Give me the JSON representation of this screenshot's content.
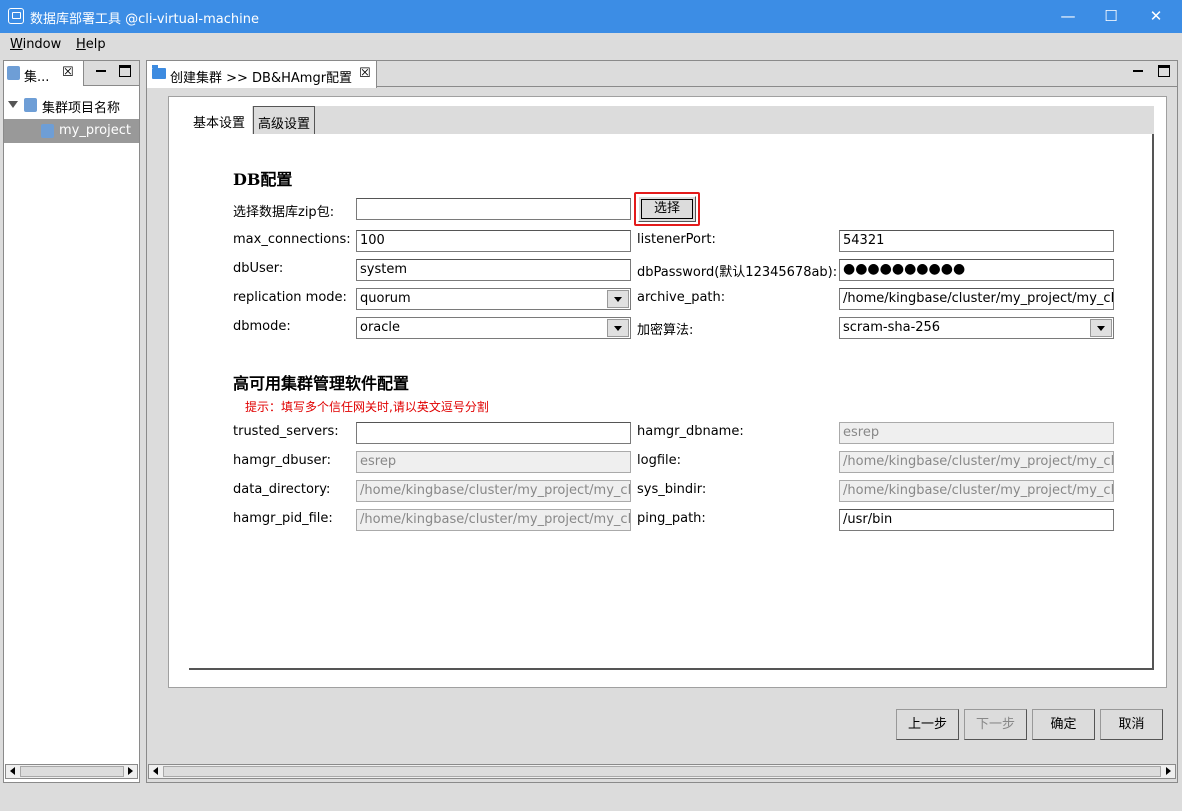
{
  "window": {
    "title": "数据库部署工具 @cli-virtual-machine",
    "controls": {
      "minimize": "—",
      "maximize": "☐",
      "close": "✕"
    }
  },
  "menubar": {
    "items": [
      {
        "label": "Window",
        "mnemonic": "W",
        "rest": "indow"
      },
      {
        "label": "Help",
        "mnemonic": "H",
        "rest": "elp"
      }
    ]
  },
  "left_panel": {
    "tab_label": "集...",
    "close": "☒",
    "tree": {
      "root": "集群项目名称",
      "children": [
        "my_project"
      ]
    }
  },
  "editor": {
    "tab_label": "创建集群 >> DB&HAmgr配置",
    "close": "☒",
    "inner_tabs": [
      "基本设置",
      "高级设置"
    ],
    "db_section": {
      "title": "DB配置",
      "zip_label": "选择数据库zip包:",
      "zip_value": "",
      "select_button": "选择",
      "max_connections_label": "max_connections:",
      "max_connections_value": "100",
      "listener_port_label": "listenerPort:",
      "listener_port_value": "54321",
      "db_user_label": "dbUser:",
      "db_user_value": "system",
      "db_password_label": "dbPassword(默认12345678ab):",
      "db_password_value": "●●●●●●●●●●",
      "replication_mode_label": "replication mode:",
      "replication_mode_value": "quorum",
      "archive_path_label": "archive_path:",
      "archive_path_value": "/home/kingbase/cluster/my_project/my_cl",
      "dbmode_label": "dbmode:",
      "dbmode_value": "oracle",
      "encryption_label": "加密算法:",
      "encryption_value": "scram-sha-256"
    },
    "ha_section": {
      "title": "高可用集群管理软件配置",
      "hint": "提示：填写多个信任网关时,请以英文逗号分割",
      "trusted_servers_label": "trusted_servers:",
      "trusted_servers_value": "",
      "hamgr_dbname_label": "hamgr_dbname:",
      "hamgr_dbname_value": "esrep",
      "hamgr_dbuser_label": "hamgr_dbuser:",
      "hamgr_dbuser_value": "esrep",
      "logfile_label": "logfile:",
      "logfile_value": "/home/kingbase/cluster/my_project/my_cl",
      "data_directory_label": "data_directory:",
      "data_directory_value": "/home/kingbase/cluster/my_project/my_cl",
      "sys_bindir_label": "sys_bindir:",
      "sys_bindir_value": "/home/kingbase/cluster/my_project/my_cl",
      "hamgr_pid_file_label": "hamgr_pid_file:",
      "hamgr_pid_file_value": "/home/kingbase/cluster/my_project/my_cl",
      "ping_path_label": "ping_path:",
      "ping_path_value": "/usr/bin"
    },
    "actions": {
      "prev": "上一步",
      "next": "下一步",
      "ok": "确定",
      "cancel": "取消"
    }
  },
  "colors": {
    "titlebar": "#3c8de5",
    "highlight_border": "#e31b1b",
    "hint_text": "#e00000",
    "tree_selected": "#999999"
  }
}
